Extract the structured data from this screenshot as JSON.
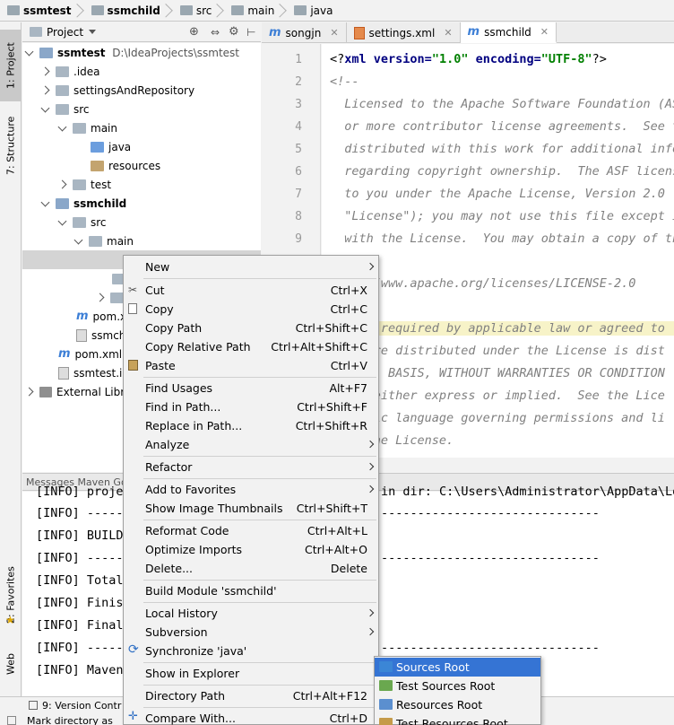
{
  "breadcrumbs": [
    "ssmtest",
    "ssmchild",
    "src",
    "main",
    "java"
  ],
  "left_strip": {
    "project": "1: Project",
    "structure": "7: Structure",
    "favorites": "2: Favorites",
    "web": "Web"
  },
  "project_panel": {
    "title": "Project",
    "tree": [
      {
        "label": "ssmtest",
        "path": "D:\\IdeaProjects\\ssmtest"
      },
      {
        "label": ".idea"
      },
      {
        "label": "settingsAndRepository"
      },
      {
        "label": "src"
      },
      {
        "label": "main"
      },
      {
        "label": "java"
      },
      {
        "label": "resources"
      },
      {
        "label": "test"
      },
      {
        "label": "ssmchild"
      },
      {
        "label": "src"
      },
      {
        "label": "main"
      },
      {
        "label": "pom.x"
      },
      {
        "label": "ssmch"
      },
      {
        "label": "pom.xml"
      },
      {
        "label": "ssmtest.i"
      },
      {
        "label": "External Libr"
      }
    ]
  },
  "editor": {
    "tabs": [
      "songjn",
      "settings.xml",
      "ssmchild"
    ],
    "line_numbers": [
      "1",
      "2",
      "3",
      "4",
      "5",
      "6",
      "7",
      "8",
      "9"
    ],
    "line1": {
      "open": "<?",
      "kw": "xml version=",
      "v1": "\"1.0\"",
      "kw2": " encoding=",
      "v2": "\"UTF-8\"",
      "close": "?>"
    },
    "lines": [
      "<!--",
      "  Licensed to the Apache Software Foundation (AS",
      "  or more contributor license agreements.  See t",
      "  distributed with this work for additional info",
      "  regarding copyright ownership.  The ASF licens",
      "  to you under the Apache License, Version 2.0 (",
      "  \"License\"); you may not use this file except i",
      "  with the License.  You may obtain a copy of th",
      "  ",
      "    ://www.apache.org/licenses/LICENSE-2.0",
      "  ",
      "     s required by applicable law or agreed to",
      "     are distributed under the License is dist",
      "     S\" BASIS, WITHOUT WARRANTIES OR CONDITION",
      "      either express or implied.  See the Lice",
      "     fic language governing permissions and li",
      "     the License."
    ]
  },
  "messages_header": "Messages Maven Go",
  "console_lines": [
    "[INFO] projec",
    "[INFO] ------",
    "[INFO] BUILD",
    "[INFO] ------",
    "[INFO] Total",
    "[INFO] Finish",
    "[INFO] Final",
    "[INFO] ------",
    "[INFO] Maven"
  ],
  "console_tail": [
    "in dir: C:\\Users\\Administrator\\AppData\\Lo",
    "------------------------------",
    "",
    "------------------------------",
    "",
    "",
    "",
    "------------------------------",
    ""
  ],
  "status_bar": {
    "version_control": "9: Version Contr",
    "hint": "Mark directory as"
  },
  "context_menu": [
    {
      "label": "New",
      "shortcut": "",
      "submenu": true
    },
    {
      "label": "Cut",
      "shortcut": "Ctrl+X"
    },
    {
      "label": "Copy",
      "shortcut": "Ctrl+C"
    },
    {
      "label": "Copy Path",
      "shortcut": "Ctrl+Shift+C"
    },
    {
      "label": "Copy Relative Path",
      "shortcut": "Ctrl+Alt+Shift+C"
    },
    {
      "label": "Paste",
      "shortcut": "Ctrl+V"
    },
    {
      "label": "Find Usages",
      "shortcut": "Alt+F7"
    },
    {
      "label": "Find in Path...",
      "shortcut": "Ctrl+Shift+F"
    },
    {
      "label": "Replace in Path...",
      "shortcut": "Ctrl+Shift+R"
    },
    {
      "label": "Analyze",
      "shortcut": "",
      "submenu": true
    },
    {
      "label": "Refactor",
      "shortcut": "",
      "submenu": true
    },
    {
      "label": "Add to Favorites",
      "shortcut": "",
      "submenu": true
    },
    {
      "label": "Show Image Thumbnails",
      "shortcut": "Ctrl+Shift+T"
    },
    {
      "label": "Reformat Code",
      "shortcut": "Ctrl+Alt+L"
    },
    {
      "label": "Optimize Imports",
      "shortcut": "Ctrl+Alt+O"
    },
    {
      "label": "Delete...",
      "shortcut": "Delete"
    },
    {
      "label": "Build Module 'ssmchild'",
      "shortcut": ""
    },
    {
      "label": "Local History",
      "shortcut": "",
      "submenu": true
    },
    {
      "label": "Subversion",
      "shortcut": "",
      "submenu": true
    },
    {
      "label": "Synchronize 'java'",
      "shortcut": ""
    },
    {
      "label": "Show in Explorer",
      "shortcut": ""
    },
    {
      "label": "Directory Path",
      "shortcut": "Ctrl+Alt+F12"
    },
    {
      "label": "Compare With...",
      "shortcut": "Ctrl+D"
    }
  ],
  "mark_as_submenu": [
    {
      "label": "Sources Root",
      "color": "#3b86d6",
      "selected": true
    },
    {
      "label": "Test Sources Root",
      "color": "#6aa84f"
    },
    {
      "label": "Resources Root",
      "color": "#5b8fcf"
    },
    {
      "label": "Test Resources Root",
      "color": "#c59b4a"
    }
  ],
  "colors": {
    "selection": "#3574d4",
    "keyword": "#000080",
    "string": "#008000",
    "comment": "#808080"
  }
}
